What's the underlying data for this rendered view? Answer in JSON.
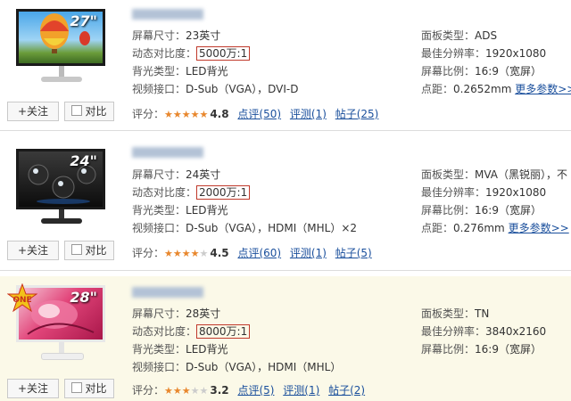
{
  "labels": {
    "screen_size": "屏幕尺寸：",
    "contrast": "动态对比度：",
    "backlight": "背光类型：",
    "video_port": "视频接口：",
    "panel": "面板类型：",
    "resolution": "最佳分辨率：",
    "ratio": "屏幕比例：",
    "pitch": "点距：",
    "rating": "评分：",
    "more_params": "更多参数>>",
    "follow_button": "+关注",
    "compare_button": "对比"
  },
  "products": [
    {
      "size_badge": "27\"",
      "screen_size": "23英寸",
      "contrast": "5000万:1",
      "backlight": "LED背光",
      "video_port": "D-Sub（VGA），DVI-D",
      "panel": "ADS",
      "resolution": "1920x1080",
      "ratio": "16:9（宽屏）",
      "pitch": "0.2652mm",
      "stars": 4.8,
      "score": "4.8",
      "comments": "点评(50)",
      "reviews": "评测(1)",
      "posts": "帖子(25)"
    },
    {
      "size_badge": "24\"",
      "screen_size": "24英寸",
      "contrast": "2000万:1",
      "backlight": "LED背光",
      "video_port": "D-Sub（VGA），HDMI（MHL）×2",
      "panel": "MVA（黑锐丽），不",
      "resolution": "1920x1080",
      "ratio": "16:9（宽屏）",
      "pitch": "0.276mm",
      "stars": 4.5,
      "score": "4.5",
      "comments": "点评(60)",
      "reviews": "评测(1)",
      "posts": "帖子(5)"
    },
    {
      "size_badge": "28\"",
      "badge": "ONE",
      "screen_size": "28英寸",
      "contrast": "8000万:1",
      "backlight": "LED背光",
      "video_port": "D-Sub（VGA），HDMI（MHL）",
      "panel": "TN",
      "resolution": "3840x2160",
      "ratio": "16:9（宽屏）",
      "stars": 3.2,
      "score": "3.2",
      "comments": "点评(5)",
      "reviews": "评测(1)",
      "posts": "帖子(2)"
    }
  ],
  "colors": {
    "link": "#1a4f9c",
    "highlight_border": "#c0392b",
    "star": "#e8872d",
    "alt_row_bg": "#fbf9e8"
  }
}
